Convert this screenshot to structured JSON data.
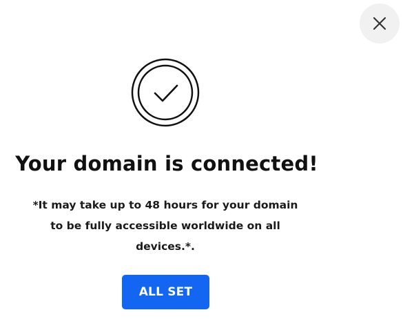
{
  "dialog": {
    "close_icon": "close-icon",
    "success_icon": "check-circle-icon",
    "title": "Your domain is connected!",
    "message_lines": [
      "*It may take up to 48 hours for your domain",
      "to be fully accessible worldwide on all",
      "devices.*."
    ],
    "primary_button_label": "ALL SET"
  },
  "colors": {
    "primary": "#1266f1",
    "close_bg": "#f1f1f1",
    "text": "#111111"
  }
}
